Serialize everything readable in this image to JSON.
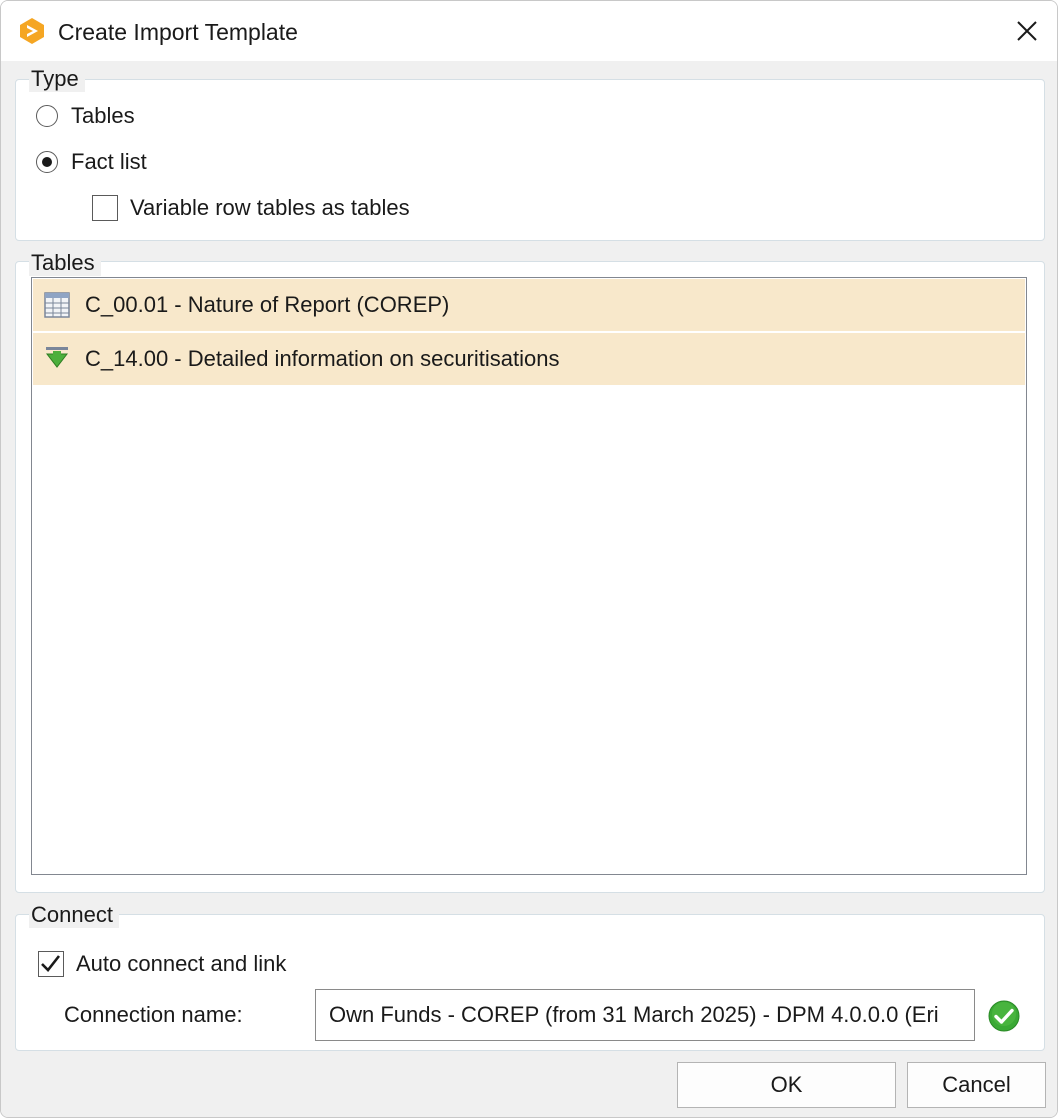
{
  "window": {
    "title": "Create Import Template"
  },
  "type_group": {
    "legend": "Type",
    "options": [
      {
        "label": "Tables",
        "selected": false
      },
      {
        "label": "Fact list",
        "selected": true
      }
    ],
    "variable_rows": {
      "label": "Variable row tables as tables",
      "checked": false
    }
  },
  "tables_group": {
    "legend": "Tables",
    "items": [
      {
        "label": "C_00.01 - Nature of Report (COREP)",
        "icon": "table-grid-icon"
      },
      {
        "label": "C_14.00 - Detailed information on securitisations",
        "icon": "green-arrow-down-icon"
      }
    ]
  },
  "connect_group": {
    "legend": "Connect",
    "auto_connect": {
      "label": "Auto connect and link",
      "checked": true
    },
    "connection_name_label": "Connection name:",
    "connection_name_value": "Own Funds - COREP (from 31 March 2025) - DPM 4.0.0.0 (Eri",
    "status_icon": "green-check-icon"
  },
  "buttons": {
    "ok": "OK",
    "cancel": "Cancel"
  },
  "colors": {
    "selection": "#f8e8cb",
    "accent_orange": "#f5a623",
    "success_green": "#3aa935"
  }
}
